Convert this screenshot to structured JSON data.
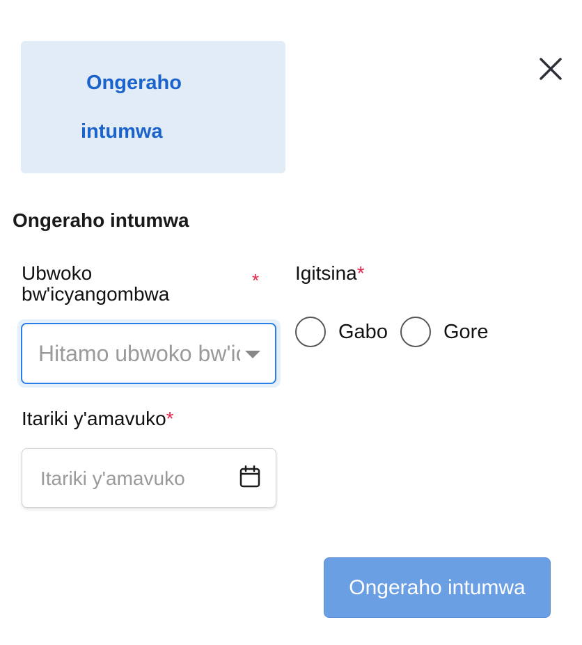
{
  "tab_card": {
    "line1": "Ongeraho",
    "line2": "intumwa"
  },
  "section_title": "Ongeraho intumwa",
  "fields": {
    "type": {
      "label": "Ubwoko bw'icyangombwa",
      "required_mark": "*",
      "placeholder": "Hitamo ubwoko bw'icyangombwa"
    },
    "gender": {
      "label": "Igitsina",
      "required_mark": "*",
      "options": [
        "Gabo",
        "Gore"
      ]
    },
    "dob": {
      "label": "Itariki y'amavuko",
      "required_mark": "*",
      "placeholder": "Itariki y'amavuko"
    }
  },
  "submit_label": "Ongeraho intumwa",
  "colors": {
    "accent": "#1b63cc",
    "card_bg": "#e1ecf7",
    "button_bg": "#6a9fe3",
    "required": "#e8254b",
    "focus_border": "#2b7de9"
  },
  "icons": {
    "close": "close-icon",
    "calendar": "calendar-icon",
    "caret": "chevron-down-icon"
  }
}
